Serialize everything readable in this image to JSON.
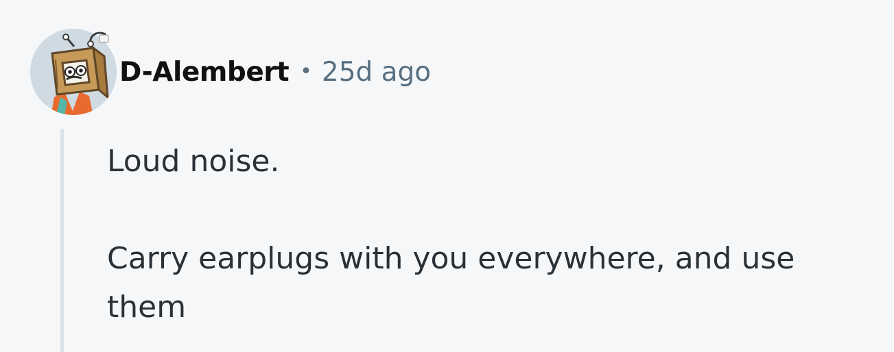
{
  "comment": {
    "author": "D-Alembert",
    "separator": "•",
    "timestamp": "25d ago",
    "avatar_icon": "cardboard-robot-avatar-icon",
    "paragraphs": [
      "Loud noise.",
      "Carry earplugs with you everywhere, and use them"
    ]
  },
  "colors": {
    "background": "#f6f7f9",
    "author": "#111111",
    "meta": "#576f80",
    "body_text": "#2a3136",
    "thread_line": "#d9e2ea"
  }
}
